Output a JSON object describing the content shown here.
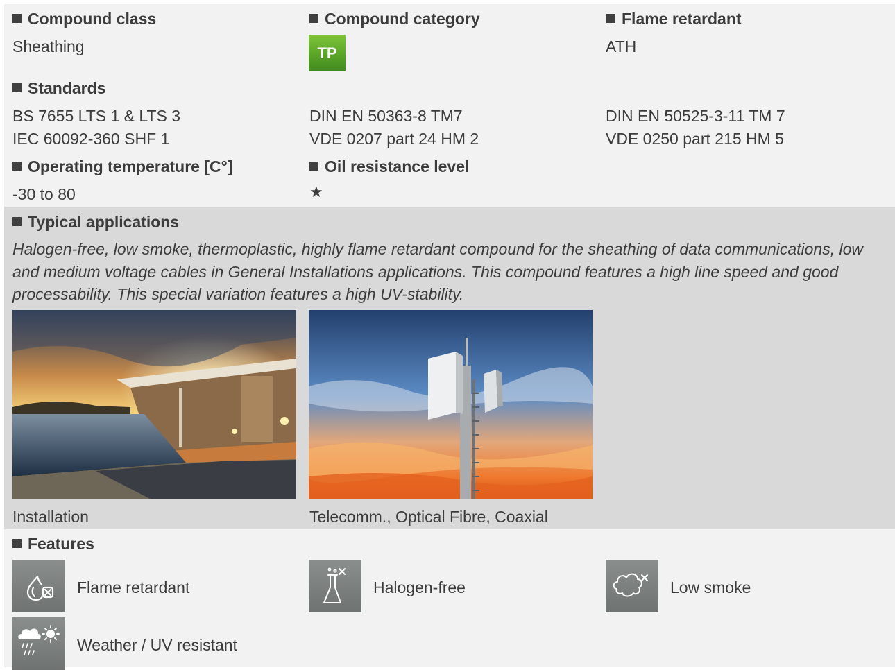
{
  "properties": {
    "compound_class": {
      "label": "Compound class",
      "value": "Sheathing"
    },
    "compound_category": {
      "label": "Compound category",
      "badge": "TP",
      "badge_color": "#5aa428"
    },
    "flame_retardant": {
      "label": "Flame retardant",
      "value": "ATH"
    }
  },
  "standards": {
    "label": "Standards",
    "col1": [
      "BS 7655 LTS 1 & LTS 3",
      "IEC 60092-360 SHF 1"
    ],
    "col2": [
      "DIN EN 50363-8 TM7",
      "VDE 0207 part 24 HM 2"
    ],
    "col3": [
      "DIN EN 50525-3-11 TM 7",
      "VDE 0250 part 215 HM 5"
    ]
  },
  "operating_temperature": {
    "label": "Operating temperature [C°]",
    "value": "-30 to 80"
  },
  "oil_resistance": {
    "label": "Oil resistance level",
    "stars": "★"
  },
  "typical_applications": {
    "label": "Typical applications",
    "text": "Halogen-free, low smoke, thermoplastic, highly flame retardant compound for the sheathing of data communications, low and medium voltage cables in General Installations applications. This compound features a high line speed and good processability. This special variation features a high UV-stability.",
    "images": [
      {
        "caption": "Installation",
        "icon": "villa-pool-sunset-photo"
      },
      {
        "caption": "Telecomm., Optical Fibre, Coaxial",
        "icon": "cell-tower-sunset-photo"
      }
    ]
  },
  "features": {
    "label": "Features",
    "items": [
      {
        "label": "Flame retardant",
        "icon": "flame-retardant-icon"
      },
      {
        "label": "Halogen-free",
        "icon": "halogen-free-icon"
      },
      {
        "label": "Low smoke",
        "icon": "low-smoke-icon"
      },
      {
        "label": "Weather / UV resistant",
        "icon": "weather-uv-icon"
      }
    ]
  },
  "colors": {
    "light_band": "#f2f2f2",
    "dark_band": "#d9d9d9",
    "text": "#3c3c3c",
    "icon_tile": "#7a7f7e"
  }
}
